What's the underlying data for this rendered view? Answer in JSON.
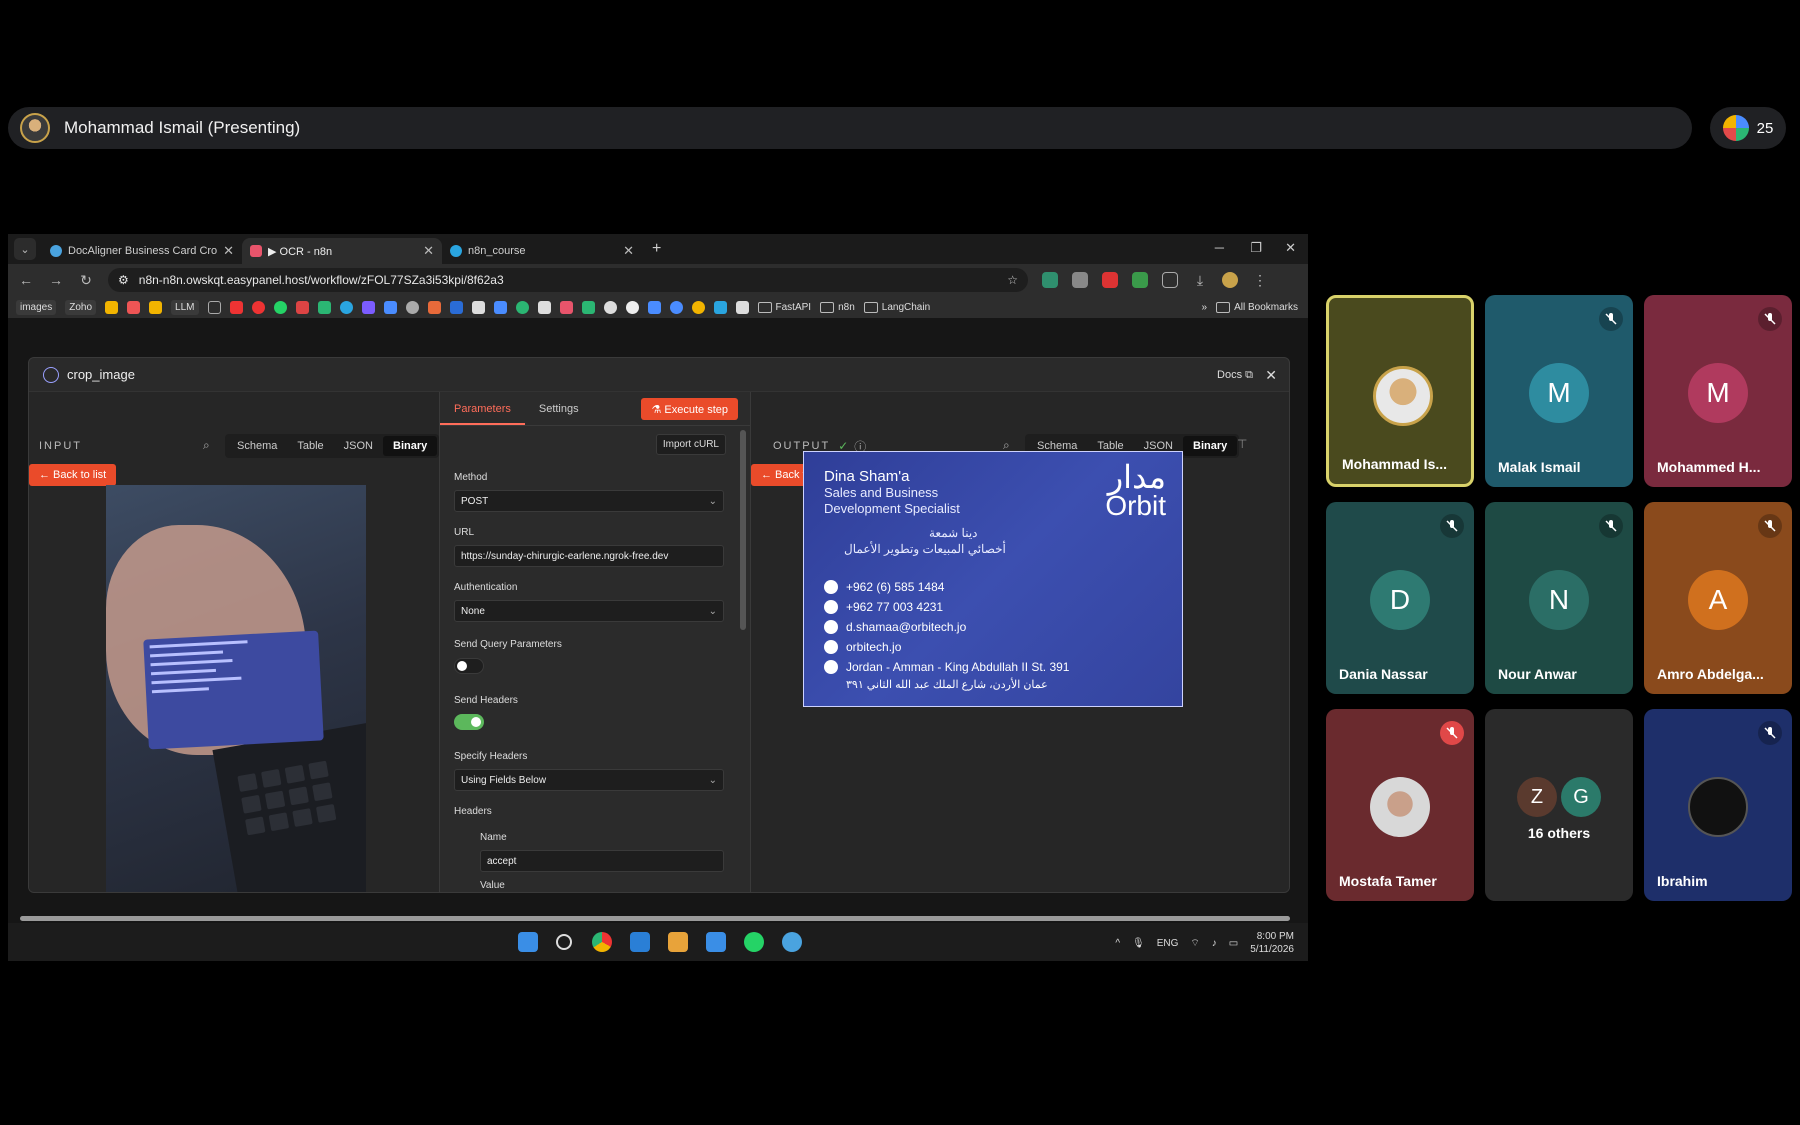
{
  "meeting": {
    "presenter": "Mohammad Ismail (Presenting)",
    "participant_count": "25"
  },
  "browser": {
    "tabs": [
      {
        "label": "DocAligner Business Card Crop"
      },
      {
        "label": "▶ OCR - n8n"
      },
      {
        "label": "n8n_course"
      }
    ],
    "url": "n8n-n8n.owskqt.easypanel.host/workflow/zFOL77SZa3i53kpi/8f62a3",
    "bookmarks": {
      "images": "images",
      "zoho": "Zoho",
      "llm": "LLM",
      "fastapi": "FastAPI",
      "n8n": "n8n",
      "langchain": "LangChain",
      "all": "All Bookmarks"
    }
  },
  "node": {
    "title": "crop_image",
    "docs": "Docs",
    "input": {
      "label": "INPUT",
      "views": [
        "Schema",
        "Table",
        "JSON",
        "Binary"
      ],
      "active_view": "Binary",
      "back": "← Back to list"
    },
    "params": {
      "tabs": [
        "Parameters",
        "Settings"
      ],
      "execute": "⚗ Execute step",
      "import_curl": "Import cURL",
      "method_label": "Method",
      "method_value": "POST",
      "url_label": "URL",
      "url_value": "https://sunday-chirurgic-earlene.ngrok-free.dev",
      "auth_label": "Authentication",
      "auth_value": "None",
      "send_query_label": "Send Query Parameters",
      "send_query_on": false,
      "send_headers_label": "Send Headers",
      "send_headers_on": true,
      "specify_headers_label": "Specify Headers",
      "specify_headers_value": "Using Fields Below",
      "headers_label": "Headers",
      "name_label": "Name",
      "name_value": "accept",
      "value_label": "Value"
    },
    "output": {
      "label": "OUTPUT",
      "views": [
        "Schema",
        "Table",
        "JSON",
        "Binary"
      ],
      "active_view": "Binary",
      "back": "← Back to list"
    },
    "card": {
      "name": "Dina Sham'a",
      "role_line1": "Sales and Business",
      "role_line2": "Development Specialist",
      "ar_name": "دينا شمعة",
      "ar_role": "أخصائي المبيعات وتطوير الأعمال",
      "logo_ar": "مدار",
      "logo_en": "Orbit",
      "phone1": "+962 (6) 585 1484",
      "phone2": "+962 77 003 4231",
      "email": "d.shamaa@orbitech.jo",
      "web": "orbitech.jo",
      "address": "Jordan - Amman - King Abdullah II St. 391",
      "address_ar": "عمان الأردن، شارع الملك عبد الله الثاني ٣٩١"
    }
  },
  "taskbar": {
    "lang": "ENG",
    "time": "8:00 PM",
    "date": "5/11/2026"
  },
  "participants": [
    {
      "name": "Mohammad Is...",
      "color": "#4a4a1e",
      "highlight": true
    },
    {
      "name": "Malak Ismail",
      "letter": "M",
      "color": "#1f5a6b",
      "avatar_color": "#2e8ca0",
      "muted": true
    },
    {
      "name": "Mohammed H...",
      "letter": "M",
      "color": "#7a2a3e",
      "avatar_color": "#b03a5e",
      "muted": true
    },
    {
      "name": "Dania Nassar",
      "letter": "D",
      "color": "#1f4a4a",
      "avatar_color": "#2e7a72",
      "muted": true
    },
    {
      "name": "Nour Anwar",
      "letter": "N",
      "color": "#1e4a44",
      "avatar_color": "#2b6e66",
      "muted": true
    },
    {
      "name": "Amro Abdelga...",
      "letter": "A",
      "color": "#8a4a1c",
      "avatar_color": "#d0701e",
      "muted": true
    },
    {
      "name": "Mostafa Tamer",
      "color": "#6a2a2e",
      "muted": true
    },
    {
      "name": "16 others",
      "letters": [
        "Z",
        "G"
      ],
      "color": "#2a2a2a"
    },
    {
      "name": "Ibrahim",
      "color": "#1e2f6a",
      "muted": true
    }
  ]
}
